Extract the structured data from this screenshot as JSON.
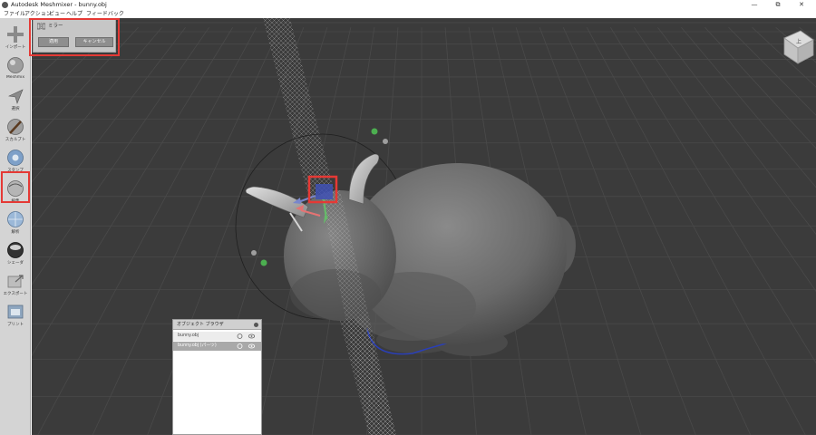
{
  "window": {
    "title": "Autodesk Meshmixer - bunny.obj",
    "minimize": "—",
    "maximize": "⧉",
    "close": "✕"
  },
  "menu": [
    "ファイル",
    "アクション",
    "ビュー",
    "ヘルプ",
    "フィードバック"
  ],
  "toolbar": [
    {
      "label": "インポート",
      "icon": "plus-icon"
    },
    {
      "label": "Meshmix",
      "icon": "meshmix-sphere-icon"
    },
    {
      "label": "選択",
      "icon": "select-arrow-icon"
    },
    {
      "label": "スカルプト",
      "icon": "sculpt-brush-icon"
    },
    {
      "label": "スタンプ",
      "icon": "stamp-icon"
    },
    {
      "label": "編集",
      "icon": "edit-sphere-icon"
    },
    {
      "label": "解析",
      "icon": "analysis-sphere-icon"
    },
    {
      "label": "シェーダ",
      "icon": "shader-sphere-icon"
    },
    {
      "label": "エクスポート",
      "icon": "export-icon"
    },
    {
      "label": "プリント",
      "icon": "print-icon"
    }
  ],
  "mirror_panel": {
    "title": "ミラー",
    "apply": "適用",
    "cancel": "キャンセル"
  },
  "object_browser": {
    "title": "オブジェクト ブラウザ",
    "items": [
      {
        "name": "bunny.obj",
        "selected": false
      },
      {
        "name": "bunny.obj (パーツ)",
        "selected": true
      }
    ]
  },
  "viewcube_label": "上",
  "colors": {
    "viewport_bg": "#3b3b3b",
    "grid": "#4a4a4a",
    "mesh": "#6e6e6e",
    "highlight_red": "#e53935",
    "boundary_blue": "#2a3fb8",
    "toolbar_bg": "#d4d4d4"
  }
}
